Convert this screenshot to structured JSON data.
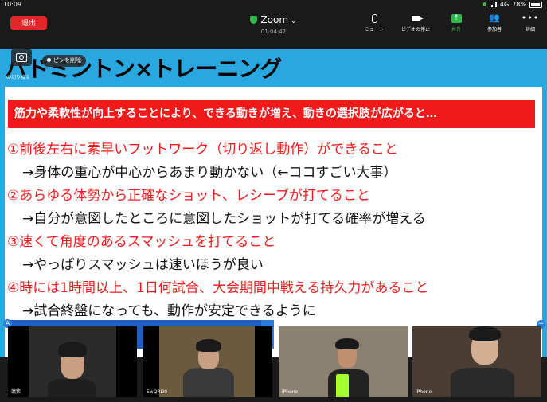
{
  "status_bar": {
    "time": "10:09",
    "network": "4G",
    "battery": "78%"
  },
  "topbar": {
    "leave_label": "退出",
    "app_name": "Zoom",
    "elapsed": "01:04:42",
    "tools": [
      {
        "label": "ミュート",
        "icon": "microphone-icon"
      },
      {
        "label": "ビデオの停止",
        "icon": "video-camera-icon"
      },
      {
        "label": "共有",
        "icon": "share-arrow-icon"
      },
      {
        "label": "参加者",
        "icon": "participants-icon"
      },
      {
        "label": "詳細",
        "icon": "more-dots-icon"
      }
    ],
    "accent": "#e02828",
    "share_color": "#2eb84b"
  },
  "overlay": {
    "switch_camera_label": "の切り換え",
    "unpin_label": "ピンを削除"
  },
  "slide": {
    "title": "バドミントン×トレーニング",
    "banner": "筋力や柔軟性が向上することにより、できる動きが増え、動きの選択肢が広がると…",
    "lines": [
      {
        "text": "①前後左右に素早いフットワーク（切り返し動作）ができること",
        "kind": "red"
      },
      {
        "text": "→身体の重心が中心からあまり動かない（←ココすごい大事）",
        "kind": "black"
      },
      {
        "text": "②あらゆる体勢から正確なショット、レシーブが打てること",
        "kind": "red"
      },
      {
        "text": "→自分が意図したところに意図したショットが打てる確率が増える",
        "kind": "black"
      },
      {
        "text": "③速くて角度のあるスマッシュを打てること",
        "kind": "red"
      },
      {
        "text": "→やっぱりスマッシュは速いほうが良い",
        "kind": "black"
      },
      {
        "text": "④時には1時間以上、1日何試合、大会期間中戦える持久力があること",
        "kind": "red"
      },
      {
        "text": "→試合終盤になっても、動作が安定できるように",
        "kind": "black"
      }
    ],
    "colors": {
      "title_bar": "#29a8e0",
      "banner": "#f11a1a",
      "point_text": "#f11a1a"
    }
  },
  "participants": [
    {
      "name": "蓮紫"
    },
    {
      "name": "EwQRD0"
    },
    {
      "name": "iPhone"
    },
    {
      "name": "iPhone"
    }
  ]
}
